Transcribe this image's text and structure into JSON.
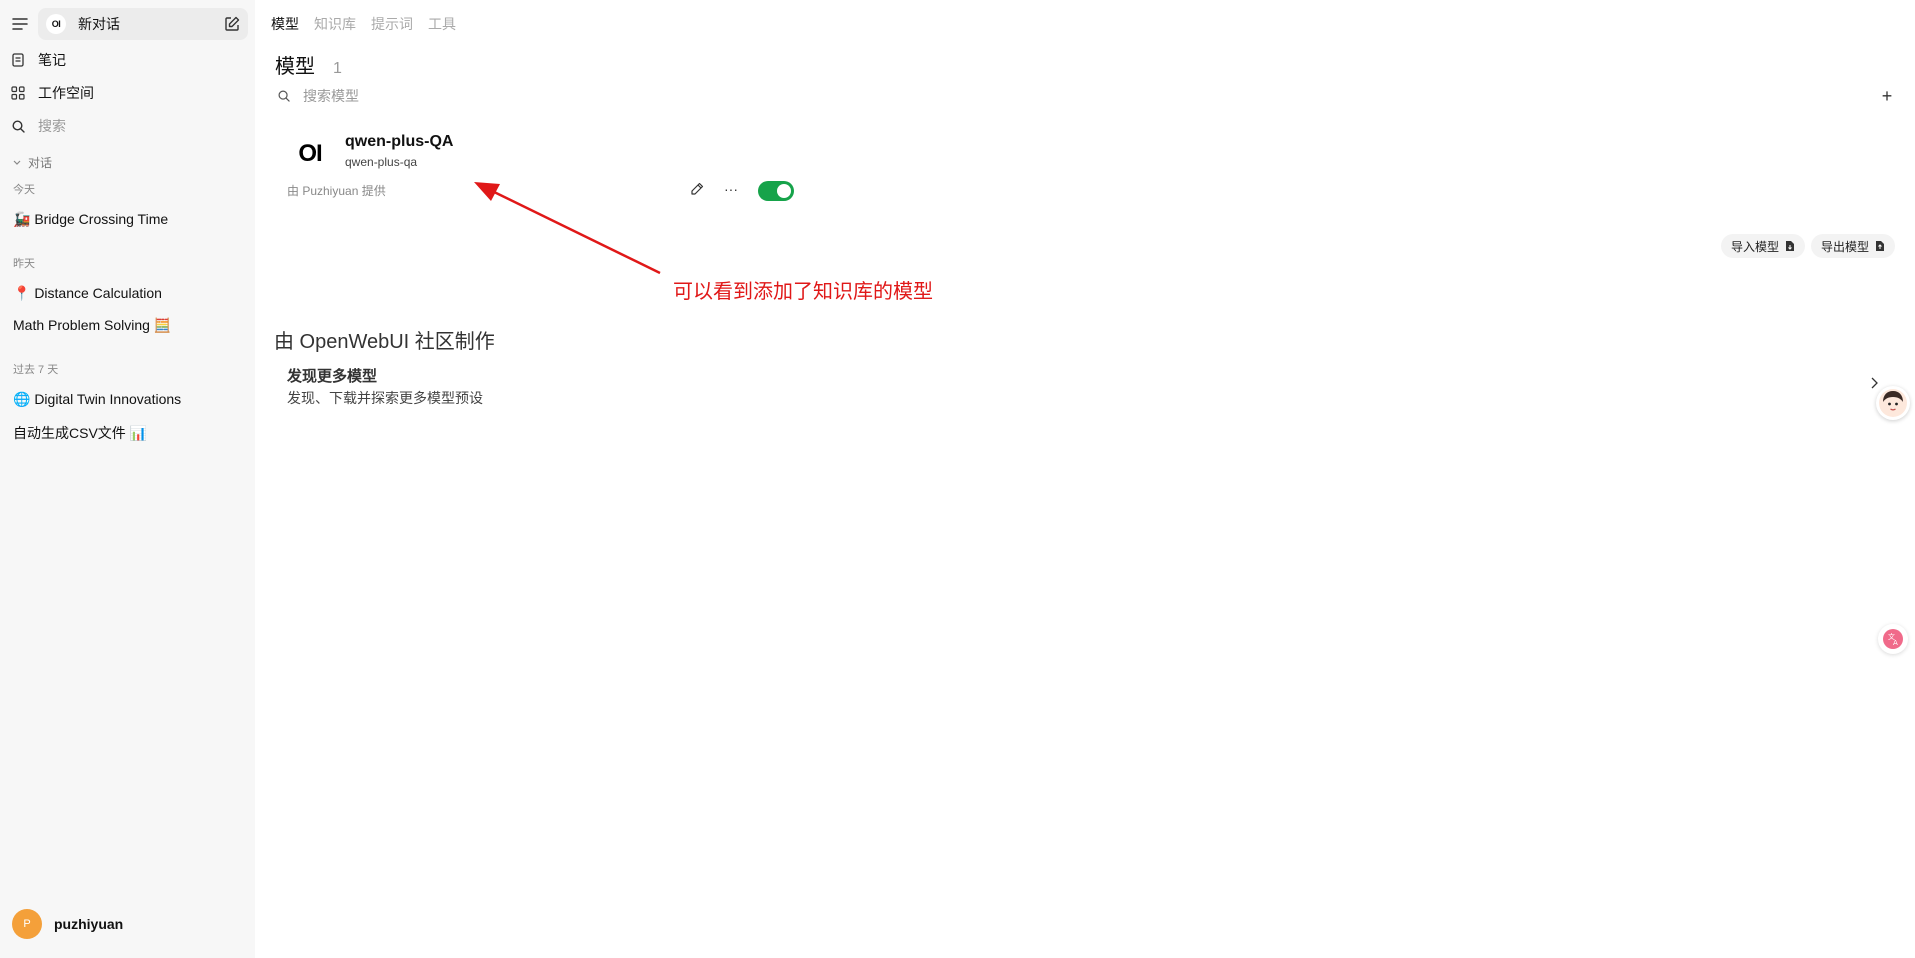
{
  "sidebar": {
    "new_chat_label": "新对话",
    "logo_text": "OI",
    "nav": {
      "notes": "笔记",
      "workspace": "工作空间",
      "search": "搜索"
    },
    "group_label": "对话",
    "sections": [
      {
        "label": "今天",
        "chats": [
          "🚂 Bridge Crossing Time"
        ]
      },
      {
        "label": "昨天",
        "chats": [
          "📍 Distance Calculation",
          "Math Problem Solving 🧮"
        ]
      },
      {
        "label": "过去 7 天",
        "chats": [
          "🌐 Digital Twin Innovations",
          "自动生成CSV文件 📊"
        ]
      }
    ],
    "user": {
      "initial": "P",
      "name": "puzhiyuan"
    }
  },
  "tabs": [
    {
      "label": "模型",
      "active": true
    },
    {
      "label": "知识库",
      "active": false
    },
    {
      "label": "提示词",
      "active": false
    },
    {
      "label": "工具",
      "active": false
    }
  ],
  "page": {
    "title": "模型",
    "count": "1",
    "search_placeholder": "搜索模型",
    "add_icon": "+"
  },
  "model": {
    "logo_text": "OI",
    "name": "qwen-plus-QA",
    "id": "qwen-plus-qa",
    "provider": "由 Puzhiyuan 提供",
    "more": "···",
    "enabled": true
  },
  "actions": {
    "import_label": "导入模型",
    "export_label": "导出模型"
  },
  "annotation": {
    "text": "可以看到添加了知识库的模型",
    "color": "#e01818"
  },
  "community": {
    "title": "由 OpenWebUI 社区制作",
    "discover_title": "发现更多模型",
    "discover_subtitle": "发现、下载并探索更多模型预设"
  },
  "colors": {
    "toggle_on": "#16a34a",
    "avatar_bg": "#f4a03a",
    "sidebar_bg": "#f7f7f7"
  }
}
